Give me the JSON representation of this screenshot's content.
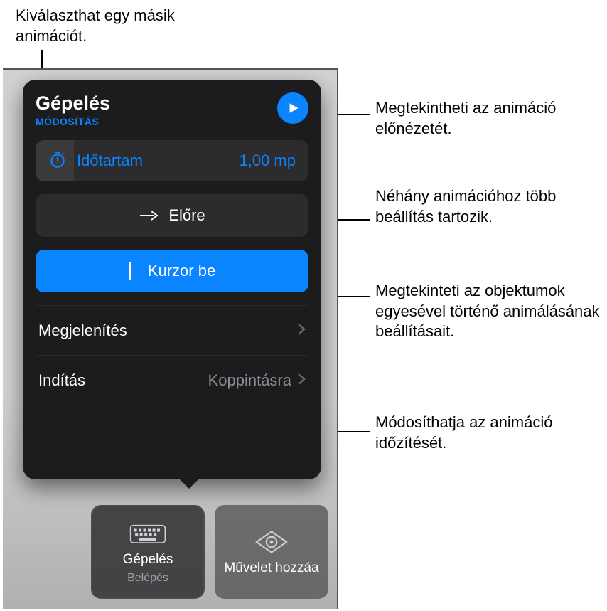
{
  "callouts": {
    "top_left": "Kiválaszthat egy másik animációt.",
    "r1": "Megtekintheti az animáció előnézetét.",
    "r2": "Néhány animációhoz több beállítás tartozik.",
    "r3": "Megtekinteti az objektumok egyesével történő animálásának beállításait.",
    "r4": "Módosíthatja az animáció időzítését."
  },
  "panel": {
    "title": "Gépelés",
    "modify_label": "MÓDOSÍTÁS",
    "duration": {
      "label": "Időtartam",
      "value": "1,00 mp"
    },
    "direction_label": "Előre",
    "cursor_label": "Kurzor be",
    "delivery_label": "Megjelenítés",
    "start": {
      "label": "Indítás",
      "value": "Koppintásra"
    }
  },
  "tiles": {
    "typing": {
      "label": "Gépelés",
      "sublabel": "Belépés"
    },
    "add_action": {
      "label": "Művelet hozzáa"
    }
  }
}
